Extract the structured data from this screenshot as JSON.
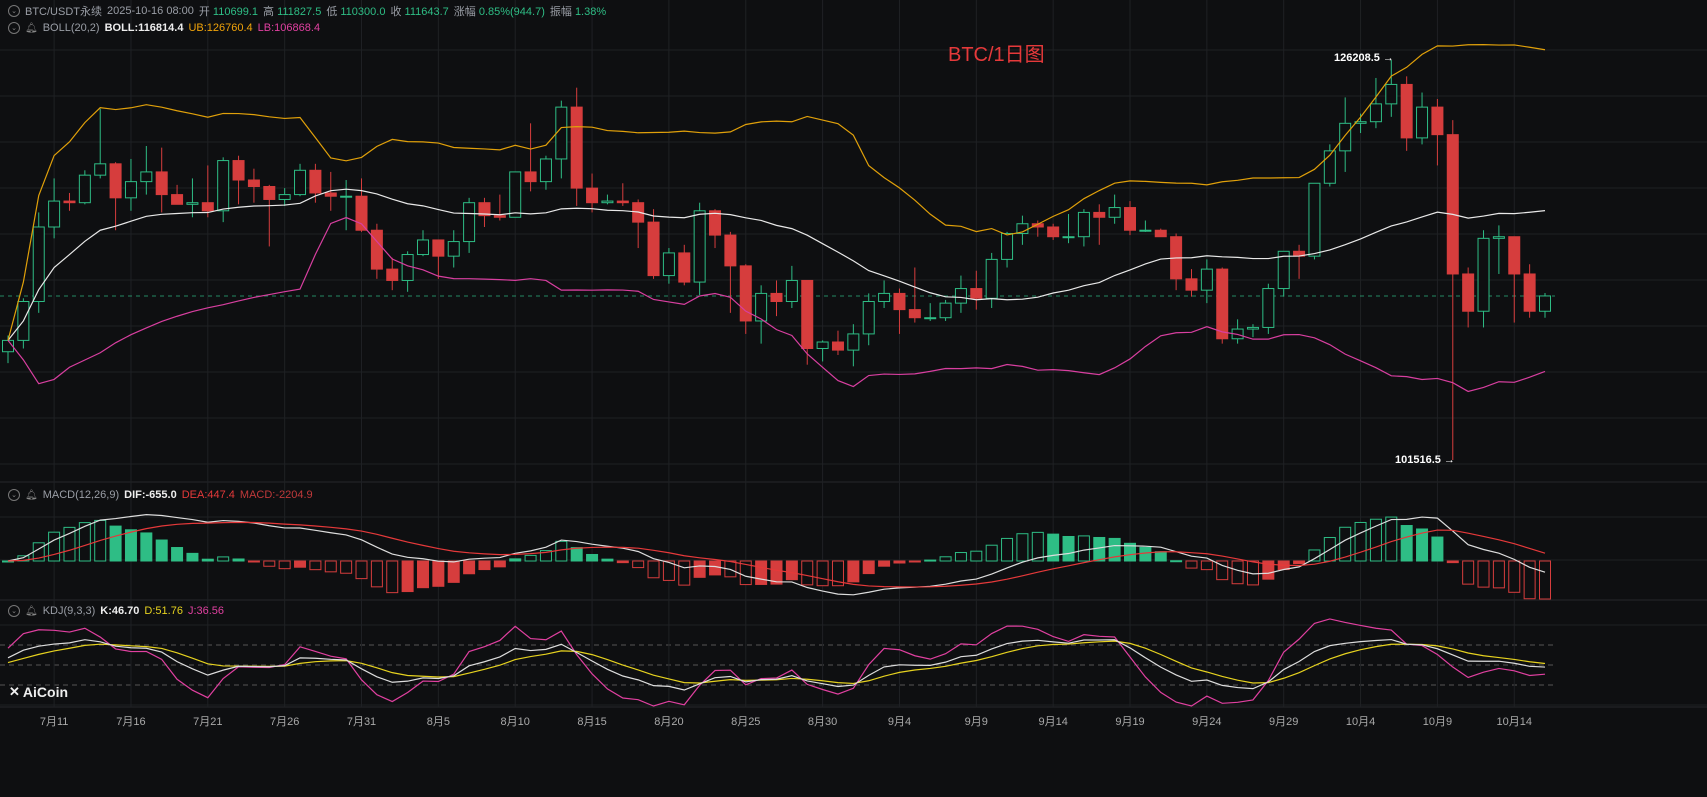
{
  "header": {
    "symbol": "BTC/USDT永续",
    "datetime": "2025-10-16 08:00",
    "open_label": "开",
    "open": "110699.1",
    "high_label": "高",
    "high": "111827.5",
    "low_label": "低",
    "low": "110300.0",
    "close_label": "收",
    "close": "111643.7",
    "change_label": "涨幅",
    "change": "0.85%(944.7)",
    "amp_label": "振幅",
    "amp": "1.38%"
  },
  "boll": {
    "name": "BOLL(20,2)",
    "mid": "BOLL:116814.4",
    "ub": "UB:126760.4",
    "lb": "LB:106868.4"
  },
  "macd": {
    "name": "MACD(12,26,9)",
    "dif": "DIF:-655.0",
    "dea": "DEA:447.4",
    "macd": "MACD:-2204.9"
  },
  "kdj": {
    "name": "KDJ(9,3,3)",
    "k": "K:46.70",
    "d": "D:51.76",
    "j": "J:36.56"
  },
  "title": "BTC/1日图",
  "max_label": "126208.5 →",
  "min_label": "101516.5 →",
  "logo": "AiCoin",
  "colors": {
    "up": "#2ebd85",
    "down": "#d63d3d",
    "boll_mid": "#e8e8e8",
    "boll_ub": "#e0a00a",
    "boll_lb": "#d83fa0",
    "dif": "#dddddd",
    "dea": "#e5393a",
    "k": "#dddddd",
    "d": "#e6d21f",
    "j": "#e040a0"
  },
  "chart_data": {
    "type": "candlestick",
    "title": "BTC/1日图",
    "start_date": "2025-07-08",
    "x_tick_labels": [
      "7月11",
      "7月16",
      "7月21",
      "7月26",
      "7月31",
      "8月5",
      "8月10",
      "8月15",
      "8月20",
      "8月25",
      "8月30",
      "9月4",
      "9月9",
      "9月14",
      "9月19",
      "9月24",
      "9月29",
      "10月4",
      "10月9",
      "10月14"
    ],
    "x_tick_index": [
      3,
      8,
      13,
      18,
      23,
      28,
      33,
      38,
      43,
      48,
      53,
      58,
      63,
      68,
      73,
      78,
      83,
      88,
      93,
      98
    ],
    "ylim": [
      101516.5,
      126208.5
    ],
    "ohlc": [
      [
        108200,
        109200,
        107500,
        108900
      ],
      [
        108900,
        111500,
        108400,
        111300
      ],
      [
        111300,
        116800,
        110600,
        115900
      ],
      [
        115900,
        118900,
        115200,
        117500
      ],
      [
        117500,
        118000,
        116900,
        117400
      ],
      [
        117400,
        119400,
        117300,
        119100
      ],
      [
        119100,
        123200,
        118900,
        119800
      ],
      [
        119800,
        119900,
        115700,
        117700
      ],
      [
        117700,
        120100,
        116900,
        118700
      ],
      [
        118700,
        120900,
        117900,
        119300
      ],
      [
        119300,
        120800,
        116800,
        117900
      ],
      [
        117900,
        118500,
        117300,
        117300
      ],
      [
        117300,
        118900,
        116500,
        117400
      ],
      [
        117400,
        119700,
        116500,
        116900
      ],
      [
        116900,
        120200,
        116200,
        120000
      ],
      [
        120000,
        120300,
        117300,
        118800
      ],
      [
        118800,
        119500,
        117400,
        118400
      ],
      [
        118400,
        118500,
        114700,
        117600
      ],
      [
        117600,
        118300,
        117200,
        117900
      ],
      [
        117900,
        119800,
        117800,
        119400
      ],
      [
        119400,
        119800,
        117400,
        118000
      ],
      [
        118000,
        119300,
        116900,
        117800
      ],
      [
        117800,
        118800,
        115700,
        117800
      ],
      [
        117800,
        118900,
        115600,
        115700
      ],
      [
        115700,
        116100,
        112700,
        113300
      ],
      [
        113300,
        114000,
        112000,
        112600
      ],
      [
        112600,
        114400,
        111900,
        114200
      ],
      [
        114200,
        115700,
        114100,
        115100
      ],
      [
        115100,
        115100,
        112700,
        114100
      ],
      [
        114100,
        115700,
        113400,
        115000
      ],
      [
        115000,
        117700,
        114300,
        117400
      ],
      [
        117400,
        117700,
        115900,
        116600
      ],
      [
        116600,
        117900,
        116300,
        116500
      ],
      [
        116500,
        119300,
        116500,
        119300
      ],
      [
        119300,
        122300,
        118100,
        118700
      ],
      [
        118700,
        120300,
        118200,
        120100
      ],
      [
        120100,
        123700,
        118900,
        123300
      ],
      [
        123300,
        124500,
        117200,
        118300
      ],
      [
        118300,
        119200,
        116800,
        117400
      ],
      [
        117400,
        117900,
        117300,
        117500
      ],
      [
        117500,
        118600,
        117200,
        117400
      ],
      [
        117400,
        117600,
        114600,
        116200
      ],
      [
        116200,
        117000,
        112700,
        112900
      ],
      [
        112900,
        114600,
        112400,
        114300
      ],
      [
        114300,
        114800,
        112300,
        112500
      ],
      [
        112500,
        117400,
        111700,
        116900
      ],
      [
        116900,
        117000,
        114600,
        115400
      ],
      [
        115400,
        115600,
        110600,
        113500
      ],
      [
        113500,
        113600,
        109300,
        110100
      ],
      [
        110100,
        112300,
        108700,
        111800
      ],
      [
        111800,
        112600,
        110400,
        111300
      ],
      [
        111300,
        113500,
        110900,
        112600
      ],
      [
        112600,
        112600,
        107400,
        108400
      ],
      [
        108400,
        108900,
        107600,
        108800
      ],
      [
        108800,
        109500,
        108000,
        108300
      ],
      [
        108300,
        109900,
        107300,
        109300
      ],
      [
        109300,
        111800,
        108600,
        111300
      ],
      [
        111300,
        112600,
        110900,
        111800
      ],
      [
        111800,
        112100,
        109300,
        110800
      ],
      [
        110800,
        113400,
        110000,
        110300
      ],
      [
        110300,
        111200,
        110100,
        110300
      ],
      [
        110300,
        111400,
        110100,
        111200
      ],
      [
        111200,
        112900,
        110600,
        112100
      ],
      [
        112100,
        113200,
        110800,
        111500
      ],
      [
        111500,
        114300,
        110900,
        113900
      ],
      [
        113900,
        115600,
        113400,
        115500
      ],
      [
        115500,
        116600,
        114800,
        116100
      ],
      [
        116100,
        116300,
        115300,
        115900
      ],
      [
        115900,
        116100,
        115100,
        115300
      ],
      [
        115300,
        116700,
        114900,
        115300
      ],
      [
        115300,
        117000,
        114700,
        116800
      ],
      [
        116800,
        117300,
        114800,
        116500
      ],
      [
        116500,
        117900,
        116100,
        117100
      ],
      [
        117100,
        117500,
        115400,
        115700
      ],
      [
        115700,
        116300,
        115600,
        115700
      ],
      [
        115700,
        115800,
        115300,
        115300
      ],
      [
        115300,
        115500,
        112000,
        112700
      ],
      [
        112700,
        113300,
        111600,
        112000
      ],
      [
        112000,
        113900,
        111200,
        113300
      ],
      [
        113300,
        113400,
        108700,
        109000
      ],
      [
        109000,
        110200,
        108700,
        109600
      ],
      [
        109600,
        109900,
        109100,
        109700
      ],
      [
        109700,
        112400,
        109300,
        112100
      ],
      [
        112100,
        114400,
        111600,
        114400
      ],
      [
        114400,
        114800,
        112700,
        114100
      ],
      [
        114100,
        118600,
        113900,
        118600
      ],
      [
        118600,
        121000,
        118400,
        120600
      ],
      [
        120600,
        123900,
        119300,
        122300
      ],
      [
        122300,
        122900,
        121700,
        122400
      ],
      [
        122400,
        125100,
        122000,
        123500
      ],
      [
        123500,
        126208.5,
        122700,
        124700
      ],
      [
        124700,
        125200,
        120600,
        121400
      ],
      [
        121400,
        124200,
        121000,
        123300
      ],
      [
        123300,
        123800,
        119700,
        121600
      ],
      [
        121600,
        122500,
        101516.5,
        113000
      ],
      [
        113000,
        113400,
        109700,
        110700
      ],
      [
        110700,
        115700,
        109700,
        115200
      ],
      [
        115200,
        116000,
        113000,
        115300
      ],
      [
        115300,
        115300,
        110000,
        113000
      ],
      [
        113000,
        113600,
        110300,
        110700
      ],
      [
        110699.1,
        111827.5,
        110300,
        111643.7
      ]
    ],
    "indicators": [
      "BOLL(20,2)",
      "MACD(12,26,9)",
      "KDJ(9,3,3)"
    ]
  }
}
